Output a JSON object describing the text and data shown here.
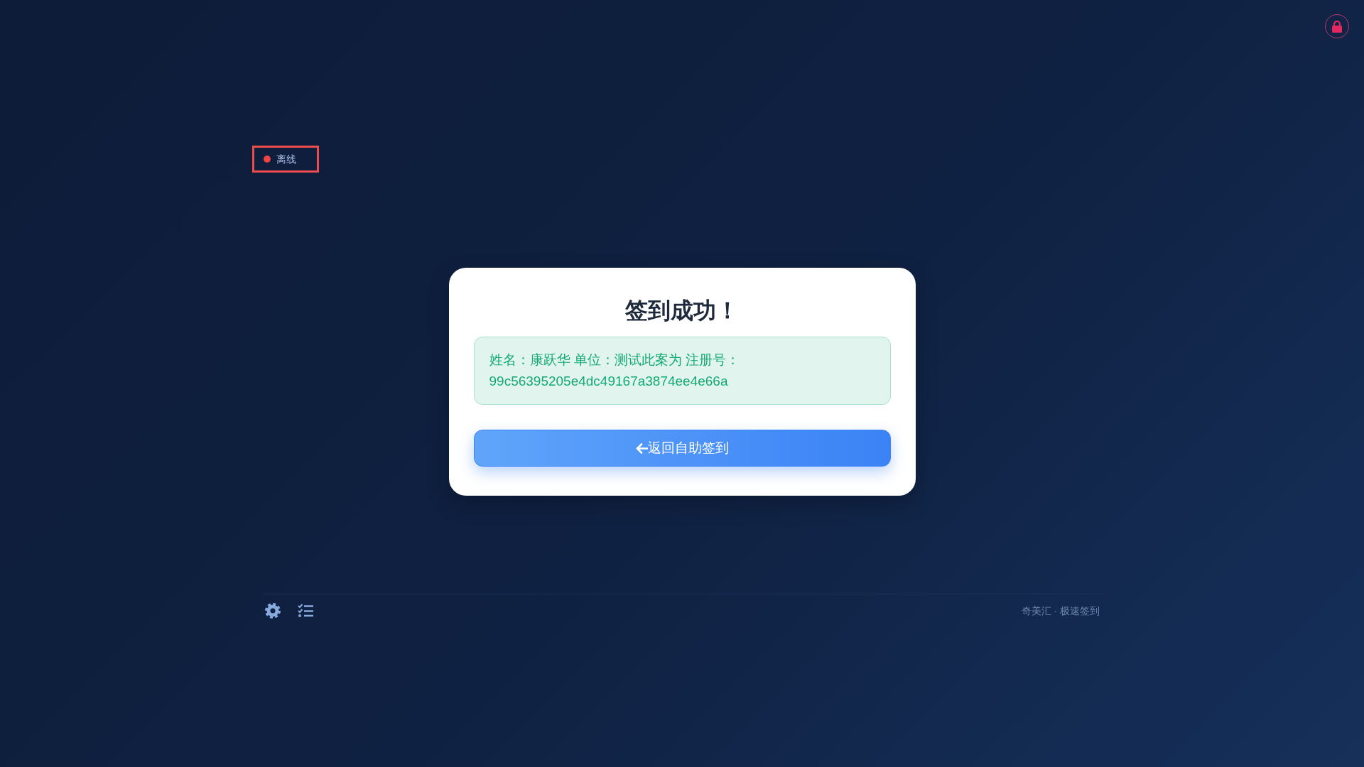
{
  "status": {
    "label": "离线",
    "online": false
  },
  "card": {
    "title": "签到成功！",
    "message": "姓名：康跃华 单位：测试此案为 注册号：99c56395205e4dc49167a3874ee4e66a",
    "back_button": "返回自助签到"
  },
  "footer": {
    "brand": "奇美汇 · 极速签到"
  }
}
